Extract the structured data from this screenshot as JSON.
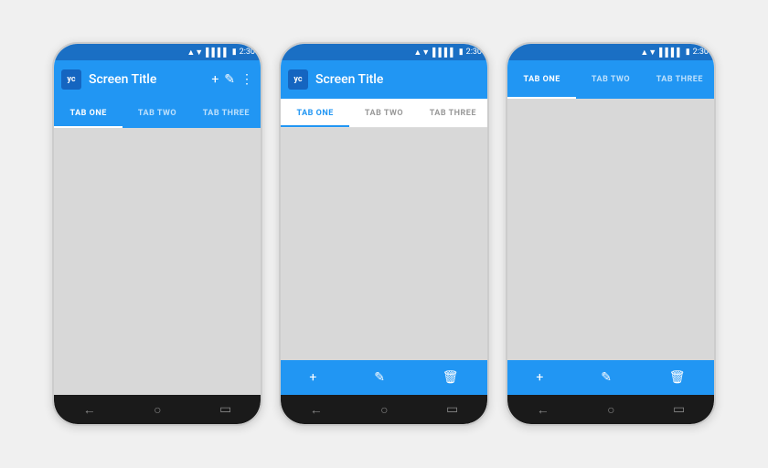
{
  "phones": [
    {
      "id": "phone1",
      "statusBar": {
        "wifi": "▲▼",
        "signal": "▌▌▌▌",
        "battery": "▮",
        "time": "2:30"
      },
      "actionBar": {
        "logo": "yc",
        "title": "Screen Title",
        "icons": [
          "+",
          "✎",
          "⋮"
        ]
      },
      "tabs": [
        {
          "label": "TAB ONE",
          "active": true
        },
        {
          "label": "TAB TWO",
          "active": false
        },
        {
          "label": "TAB THREE",
          "active": false
        }
      ],
      "tabStyle": "dark",
      "hasBottomBar": false,
      "hasNavBar": true,
      "navIcons": [
        "←",
        "○",
        "▭"
      ]
    },
    {
      "id": "phone2",
      "statusBar": {
        "wifi": "▲▼",
        "signal": "▌▌▌▌",
        "battery": "▮",
        "time": "2:30"
      },
      "actionBar": {
        "logo": "yc",
        "title": "Screen Title",
        "icons": []
      },
      "tabs": [
        {
          "label": "TAB ONE",
          "active": true
        },
        {
          "label": "TAB TWO",
          "active": false
        },
        {
          "label": "TAB THREE",
          "active": false
        }
      ],
      "tabStyle": "light",
      "hasBottomBar": true,
      "bottomIcons": [
        "+",
        "✎",
        "🗑"
      ],
      "hasNavBar": true,
      "navIcons": [
        "←",
        "○",
        "▭"
      ]
    },
    {
      "id": "phone3",
      "statusBar": {
        "wifi": "▲▼",
        "signal": "▌▌▌▌",
        "battery": "▮",
        "time": "2:30"
      },
      "actionBar": null,
      "tabs": [
        {
          "label": "TAB ONE",
          "active": true
        },
        {
          "label": "TAB TWO",
          "active": false
        },
        {
          "label": "TAB THREE",
          "active": false
        }
      ],
      "tabStyle": "dark",
      "hasBottomBar": true,
      "bottomIcons": [
        "+",
        "✎",
        "🗑"
      ],
      "hasNavBar": true,
      "navIcons": [
        "←",
        "○",
        "▭"
      ]
    }
  ]
}
